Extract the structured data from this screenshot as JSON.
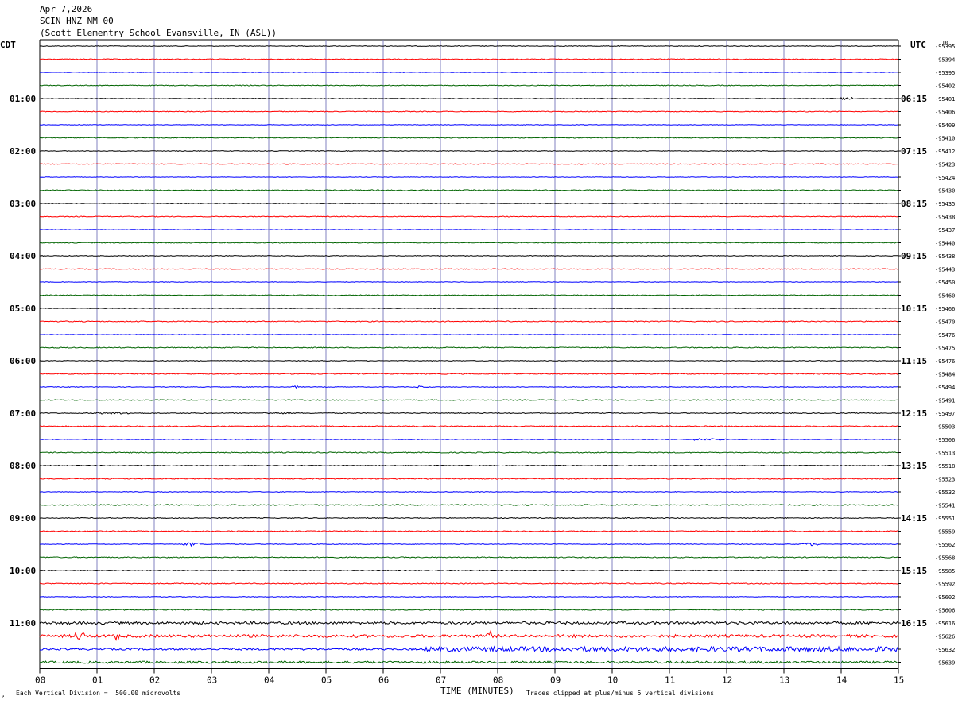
{
  "header": {
    "date": "Apr 7,2026",
    "station": "SCIN HNZ NM 00",
    "location": "(Scott Elementry School Evansville, IN (ASL))"
  },
  "footer": {
    "scale_note": "Each Vertical Division =  500.00 microvolts",
    "xlabel": "TIME (MINUTES)",
    "clip_note": "Traces clipped at plus/minus 5 vertical divisions"
  },
  "chart_data": {
    "type": "line",
    "title": "SCIN HNZ NM 00",
    "left_axis_label": "CDT",
    "right_axis_label": "UTC",
    "dc_label": "DC",
    "xlabel": "TIME (MINUTES)",
    "xlim": [
      0,
      15
    ],
    "x_ticks": [
      "00",
      "01",
      "02",
      "03",
      "04",
      "05",
      "06",
      "07",
      "08",
      "09",
      "10",
      "11",
      "12",
      "13",
      "14",
      "15"
    ],
    "rows_per_hour": 4,
    "trace_colors": [
      "#000000",
      "#ff0000",
      "#0000ff",
      "#006400"
    ],
    "grid_color": "#8080c0",
    "cdt_labels": [
      {
        "row": 4,
        "text": "01:00"
      },
      {
        "row": 8,
        "text": "02:00"
      },
      {
        "row": 12,
        "text": "03:00"
      },
      {
        "row": 16,
        "text": "04:00"
      },
      {
        "row": 20,
        "text": "05:00"
      },
      {
        "row": 24,
        "text": "06:00"
      },
      {
        "row": 28,
        "text": "07:00"
      },
      {
        "row": 32,
        "text": "08:00"
      },
      {
        "row": 36,
        "text": "09:00"
      },
      {
        "row": 40,
        "text": "10:00"
      },
      {
        "row": 44,
        "text": "11:00"
      }
    ],
    "utc_labels": [
      {
        "row": 4,
        "text": "06:15"
      },
      {
        "row": 8,
        "text": "07:15"
      },
      {
        "row": 12,
        "text": "08:15"
      },
      {
        "row": 16,
        "text": "09:15"
      },
      {
        "row": 20,
        "text": "10:15"
      },
      {
        "row": 24,
        "text": "11:15"
      },
      {
        "row": 28,
        "text": "12:15"
      },
      {
        "row": 32,
        "text": "13:15"
      },
      {
        "row": 36,
        "text": "14:15"
      },
      {
        "row": 40,
        "text": "15:15"
      },
      {
        "row": 44,
        "text": "16:15"
      }
    ],
    "dc_offsets": [
      "-95395",
      "-95394",
      "-95395",
      "-95402",
      "-95401",
      "-95406",
      "-95409",
      "-95410",
      "-95412",
      "-95423",
      "-95424",
      "-95430",
      "-95435",
      "-95438",
      "-95437",
      "-95440",
      "-95438",
      "-95443",
      "-95450",
      "-95460",
      "-95466",
      "-95470",
      "-95476",
      "-95475",
      "-95476",
      "-95484",
      "-95494",
      "-95491",
      "-95497",
      "-95503",
      "-95506",
      "-95513",
      "-95518",
      "-95523",
      "-95532",
      "-95541",
      "-95551",
      "-95559",
      "-95562",
      "-95568",
      "-95585",
      "-95592",
      "-95602",
      "-95606",
      "-95616",
      "-95626",
      "-95632",
      "-95639"
    ],
    "row_noise": [
      0.4,
      0.5,
      0.3,
      0.5,
      0.4,
      0.5,
      0.3,
      0.5,
      0.4,
      0.5,
      0.3,
      0.6,
      0.4,
      0.5,
      0.3,
      0.5,
      0.4,
      0.5,
      0.3,
      0.5,
      0.4,
      0.6,
      0.3,
      0.6,
      0.4,
      0.6,
      0.4,
      0.6,
      0.5,
      0.6,
      0.4,
      0.6,
      0.5,
      0.6,
      0.4,
      0.7,
      0.5,
      0.6,
      0.4,
      0.6,
      0.5,
      0.6,
      0.4,
      0.6,
      1.6,
      1.8,
      1.2,
      1.4
    ],
    "events": [
      {
        "row": 4,
        "minute": 14.0,
        "amplitude": 1.5,
        "duration_min": 0.2
      },
      {
        "row": 26,
        "minute": 4.4,
        "amplitude": 1.5,
        "duration_min": 0.1
      },
      {
        "row": 26,
        "minute": 6.55,
        "amplitude": 2.0,
        "duration_min": 0.15
      },
      {
        "row": 28,
        "minute": 1.0,
        "amplitude": 1.2,
        "duration_min": 0.6
      },
      {
        "row": 28,
        "minute": 3.9,
        "amplitude": 1.0,
        "duration_min": 0.5
      },
      {
        "row": 30,
        "minute": 11.4,
        "amplitude": 1.2,
        "duration_min": 0.6
      },
      {
        "row": 38,
        "minute": 2.5,
        "amplitude": 2.0,
        "duration_min": 0.3
      },
      {
        "row": 38,
        "minute": 13.3,
        "amplitude": 1.8,
        "duration_min": 0.3
      },
      {
        "row": 45,
        "minute": 0.6,
        "amplitude": 5.0,
        "duration_min": 0.2
      },
      {
        "row": 45,
        "minute": 1.33,
        "amplitude": 6.0,
        "duration_min": 0.05
      },
      {
        "row": 45,
        "minute": 7.8,
        "amplitude": 7.0,
        "duration_min": 0.08
      },
      {
        "row": 46,
        "minute": 6.7,
        "amplitude": 3.0,
        "duration_min": 8.3
      }
    ]
  }
}
